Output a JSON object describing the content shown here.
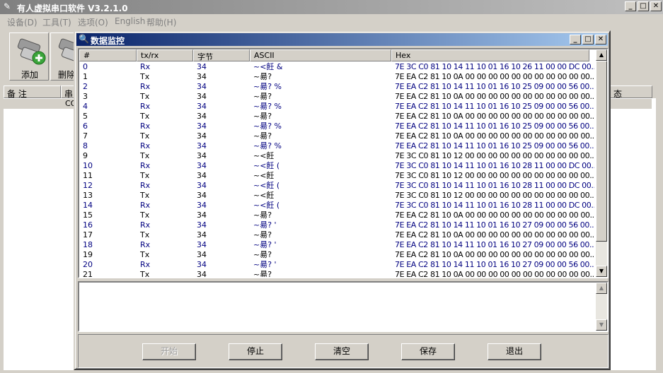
{
  "app": {
    "title": "有人虚拟串口软件 V3.2.1.0"
  },
  "menu": [
    "设备(D)",
    "工具(T)",
    "选项(O)",
    "English",
    "帮助(H)"
  ],
  "toolbar": {
    "add_label": "添加",
    "delete_label": "删除"
  },
  "device_list": {
    "headers": [
      "备 注",
      "串",
      "态"
    ],
    "row_text": "CO"
  },
  "dialog": {
    "title": "数据监控",
    "columns": [
      "#",
      "tx/rx",
      "字节",
      "ASCII",
      "Hex"
    ],
    "rows": [
      {
        "n": "0",
        "dir": "Rx",
        "len": "34",
        "ascii": "~<飪      &",
        "hex": "7E 3C C0 81 10 14 11 10 01 16 10 26 11 00 00 DC 00..."
      },
      {
        "n": "1",
        "dir": "Tx",
        "len": "34",
        "ascii": "~昜?",
        "hex": "7E EA C2 81 10 0A 00 00 00 00 00 00 00 00 00 00 00..."
      },
      {
        "n": "2",
        "dir": "Rx",
        "len": "34",
        "ascii": "~昜?    %",
        "hex": "7E EA C2 81 10 14 11 10 01 16 10 25 09 00 00 56 00..."
      },
      {
        "n": "3",
        "dir": "Tx",
        "len": "34",
        "ascii": "~昜?",
        "hex": "7E EA C2 81 10 0A 00 00 00 00 00 00 00 00 00 00 00..."
      },
      {
        "n": "4",
        "dir": "Rx",
        "len": "34",
        "ascii": "~昜?    %",
        "hex": "7E EA C2 81 10 14 11 10 01 16 10 25 09 00 00 56 00..."
      },
      {
        "n": "5",
        "dir": "Tx",
        "len": "34",
        "ascii": "~昜?",
        "hex": "7E EA C2 81 10 0A 00 00 00 00 00 00 00 00 00 00 00..."
      },
      {
        "n": "6",
        "dir": "Rx",
        "len": "34",
        "ascii": "~昜?    %",
        "hex": "7E EA C2 81 10 14 11 10 01 16 10 25 09 00 00 56 00..."
      },
      {
        "n": "7",
        "dir": "Tx",
        "len": "34",
        "ascii": "~昜?",
        "hex": "7E EA C2 81 10 0A 00 00 00 00 00 00 00 00 00 00 00..."
      },
      {
        "n": "8",
        "dir": "Rx",
        "len": "34",
        "ascii": "~昜?    %",
        "hex": "7E EA C2 81 10 14 11 10 01 16 10 25 09 00 00 56 00..."
      },
      {
        "n": "9",
        "dir": "Tx",
        "len": "34",
        "ascii": "~<飪",
        "hex": "7E 3C C0 81 10 12 00 00 00 00 00 00 00 00 00 00 00..."
      },
      {
        "n": "10",
        "dir": "Rx",
        "len": "34",
        "ascii": "~<飪      (",
        "hex": "7E 3C C0 81 10 14 11 10 01 16 10 28 11 00 00 DC 00..."
      },
      {
        "n": "11",
        "dir": "Tx",
        "len": "34",
        "ascii": "~<飪",
        "hex": "7E 3C C0 81 10 12 00 00 00 00 00 00 00 00 00 00 00..."
      },
      {
        "n": "12",
        "dir": "Rx",
        "len": "34",
        "ascii": "~<飪      (",
        "hex": "7E 3C C0 81 10 14 11 10 01 16 10 28 11 00 00 DC 00..."
      },
      {
        "n": "13",
        "dir": "Tx",
        "len": "34",
        "ascii": "~<飪",
        "hex": "7E 3C C0 81 10 12 00 00 00 00 00 00 00 00 00 00 00..."
      },
      {
        "n": "14",
        "dir": "Rx",
        "len": "34",
        "ascii": "~<飪      (",
        "hex": "7E 3C C0 81 10 14 11 10 01 16 10 28 11 00 00 DC 00..."
      },
      {
        "n": "15",
        "dir": "Tx",
        "len": "34",
        "ascii": "~昜?",
        "hex": "7E EA C2 81 10 0A 00 00 00 00 00 00 00 00 00 00 00..."
      },
      {
        "n": "16",
        "dir": "Rx",
        "len": "34",
        "ascii": "~昜?    '",
        "hex": "7E EA C2 81 10 14 11 10 01 16 10 27 09 00 00 56 00..."
      },
      {
        "n": "17",
        "dir": "Tx",
        "len": "34",
        "ascii": "~昜?",
        "hex": "7E EA C2 81 10 0A 00 00 00 00 00 00 00 00 00 00 00..."
      },
      {
        "n": "18",
        "dir": "Rx",
        "len": "34",
        "ascii": "~昜?    '",
        "hex": "7E EA C2 81 10 14 11 10 01 16 10 27 09 00 00 56 00..."
      },
      {
        "n": "19",
        "dir": "Tx",
        "len": "34",
        "ascii": "~昜?",
        "hex": "7E EA C2 81 10 0A 00 00 00 00 00 00 00 00 00 00 00..."
      },
      {
        "n": "20",
        "dir": "Rx",
        "len": "34",
        "ascii": "~昜?    '",
        "hex": "7E EA C2 81 10 14 11 10 01 16 10 27 09 00 00 56 00..."
      },
      {
        "n": "21",
        "dir": "Tx",
        "len": "34",
        "ascii": "~昜?",
        "hex": "7E EA C2 81 10 0A 00 00 00 00 00 00 00 00 00 00 00..."
      }
    ],
    "buttons": {
      "start": "开始",
      "stop": "停止",
      "clear": "清空",
      "save": "保存",
      "exit": "退出"
    }
  },
  "colors": {
    "rx_text": "#000080",
    "tx_text": "#000000",
    "dialog_title": "#0a246a"
  }
}
